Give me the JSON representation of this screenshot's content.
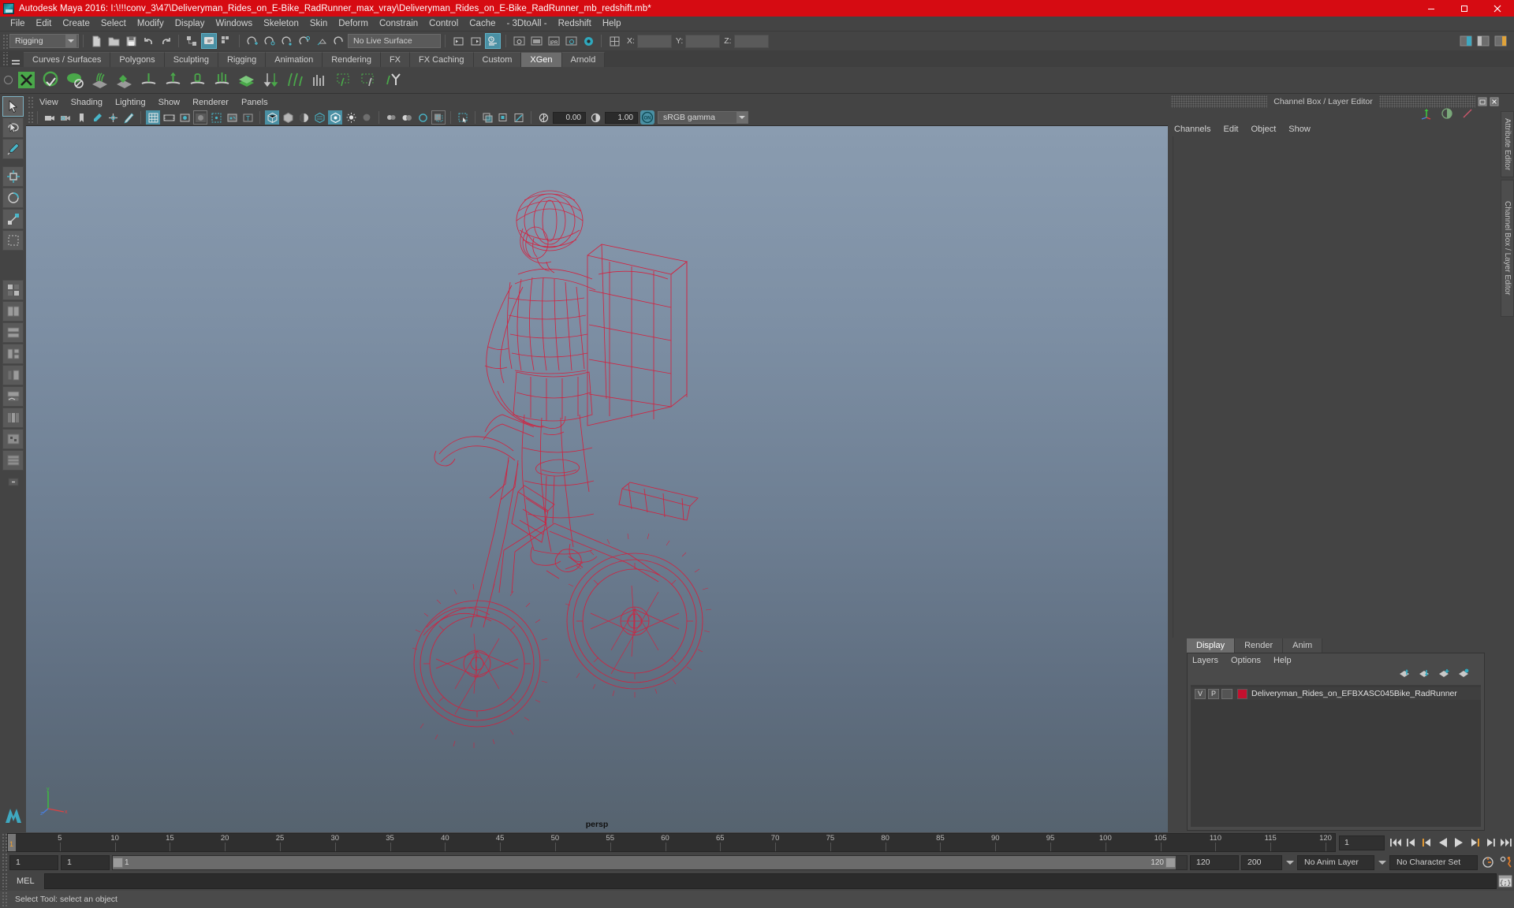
{
  "window": {
    "title": "Autodesk Maya 2016: I:\\!!!conv_3\\47\\Deliveryman_Rides_on_E-Bike_RadRunner_max_vray\\Deliveryman_Rides_on_E-Bike_RadRunner_mb_redshift.mb*",
    "minimize": "–",
    "maximize": "❐",
    "close": "✕",
    "accent_color": "#d60b12"
  },
  "menubar": {
    "items": [
      "File",
      "Edit",
      "Create",
      "Select",
      "Modify",
      "Display",
      "Windows",
      "Skeleton",
      "Skin",
      "Deform",
      "Constrain",
      "Control",
      "Cache",
      "- 3DtoAll -",
      "Redshift",
      "Help"
    ]
  },
  "statusline": {
    "menuset": "Rigging",
    "live_surface": "No Live Surface",
    "x_label": "X:",
    "y_label": "Y:",
    "z_label": "Z:",
    "x_value": "",
    "y_value": "",
    "z_value": ""
  },
  "shelf": {
    "tabs": [
      "Curves / Surfaces",
      "Polygons",
      "Sculpting",
      "Rigging",
      "Animation",
      "Rendering",
      "FX",
      "FX Caching",
      "Custom",
      "XGen",
      "Arnold"
    ],
    "active_tab": "XGen"
  },
  "viewport_panel": {
    "menus": [
      "View",
      "Shading",
      "Lighting",
      "Show",
      "Renderer",
      "Panels"
    ],
    "exposure_value": "0.00",
    "gamma_value": "1.00",
    "color_mode_toggle": "ON",
    "color_profile": "sRGB gamma",
    "camera_label": "persp",
    "axis_x": "x",
    "axis_y": "y",
    "axis_z": "z"
  },
  "right_panel": {
    "title": "Channel Box / Layer Editor",
    "restore_icon": "restore-icon",
    "close_icon": "close-icon",
    "channelbox_menus": [
      "Channels",
      "Edit",
      "Object",
      "Show"
    ],
    "layer_tabs": [
      "Display",
      "Render",
      "Anim"
    ],
    "active_layer_tab": "Display",
    "layer_menus": [
      "Layers",
      "Options",
      "Help"
    ],
    "layers": [
      {
        "visible": "V",
        "playback": "P",
        "shading": "",
        "color": "#c4102e",
        "name": "Deliveryman_Rides_on_EFBXASC045Bike_RadRunner"
      }
    ]
  },
  "vertical_tabs": [
    "Attribute Editor",
    "Channel Box / Layer Editor"
  ],
  "timeline": {
    "ticks": [
      5,
      10,
      15,
      20,
      25,
      30,
      35,
      40,
      45,
      50,
      55,
      60,
      65,
      70,
      75,
      80,
      85,
      90,
      95,
      100,
      105,
      110,
      115,
      120
    ],
    "start": 1,
    "end": 120,
    "current_frame": "1",
    "current_frame_field": "1",
    "playback_buttons": [
      "go-to-start",
      "step-back-key",
      "step-back-frame",
      "play-backwards",
      "play-forwards",
      "step-forward-frame",
      "step-forward-key",
      "go-to-end"
    ]
  },
  "range_slider": {
    "anim_start": "1",
    "playback_start": "1",
    "bar_start_label": "1",
    "bar_end_label": "120",
    "playback_end": "120",
    "anim_end": "200",
    "anim_layer": "No Anim Layer",
    "character_set": "No Character Set",
    "auto_key_icon": "auto-key-icon",
    "anim_prefs_icon": "animation-preferences-icon"
  },
  "command_line": {
    "language": "MEL",
    "input_value": "",
    "script_editor_icon": "script-editor-icon"
  },
  "help_line": {
    "text": "Select Tool: select an object"
  },
  "model": {
    "wireframe_color": "#d61e3c",
    "subject": "deliveryman-on-e-bike-wireframe"
  }
}
